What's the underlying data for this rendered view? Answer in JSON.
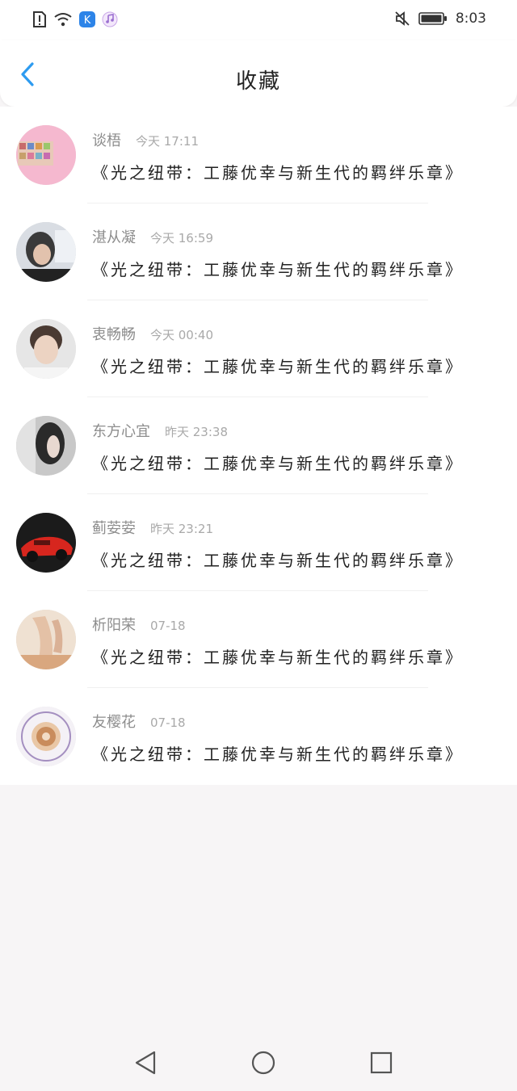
{
  "status_bar": {
    "time": "8:03",
    "icons": [
      "alert-icon",
      "wifi-icon",
      "k-app-icon",
      "music-icon",
      "mute-icon",
      "battery-icon"
    ],
    "k_app_letter": "K"
  },
  "header": {
    "title": "收藏"
  },
  "colors": {
    "accent": "#2d9bf0",
    "name": "#8d8d8d",
    "time": "#a9a9a9",
    "title": "#222222"
  },
  "items": [
    {
      "name": "谈梧",
      "time": "今天 17:11",
      "title": "《光之纽带：工藤优幸与新生代的羁绊乐章》"
    },
    {
      "name": "湛从凝",
      "time": "今天 16:59",
      "title": "《光之纽带：工藤优幸与新生代的羁绊乐章》"
    },
    {
      "name": "衷畅畅",
      "time": "今天 00:40",
      "title": "《光之纽带：工藤优幸与新生代的羁绊乐章》"
    },
    {
      "name": "东方心宜",
      "time": "昨天 23:38",
      "title": "《光之纽带：工藤优幸与新生代的羁绊乐章》"
    },
    {
      "name": "蓟荌荌",
      "time": "昨天 23:21",
      "title": "《光之纽带：工藤优幸与新生代的羁绊乐章》"
    },
    {
      "name": "析阳荣",
      "time": "07-18",
      "title": "《光之纽带：工藤优幸与新生代的羁绊乐章》"
    },
    {
      "name": "友樱花",
      "time": "07-18",
      "title": "《光之纽带：工藤优幸与新生代的羁绊乐章》"
    }
  ]
}
